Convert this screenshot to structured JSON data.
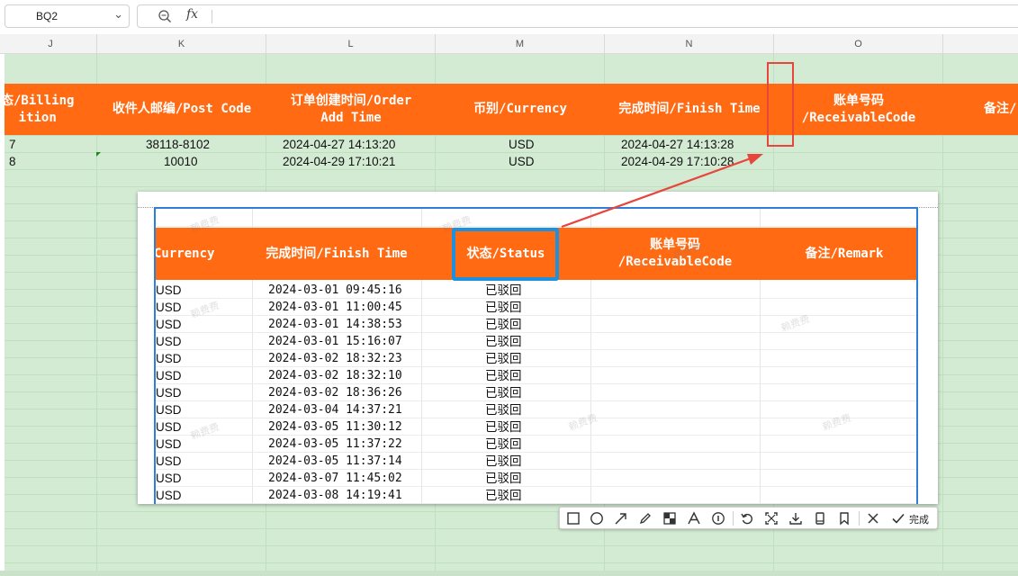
{
  "formula_bar": {
    "name_box": "BQ2",
    "zoom_icon": "zoom-icon",
    "fx_label": "fx",
    "formula": ""
  },
  "columns": [
    "J",
    "K",
    "L",
    "M",
    "N",
    "O"
  ],
  "sheet": {
    "headers": {
      "billing": "态/Billing\nition",
      "post_code": "收件人邮编/Post Code",
      "order_time": "订单创建时间/Order\nAdd Time",
      "currency": "币别/Currency",
      "finish_time": "完成时间/Finish Time",
      "receivable": "账单号码\n/ReceivableCode",
      "remark": "备注/"
    },
    "rows": [
      {
        "j": "7",
        "post_code": "38118-8102",
        "order_time": "2024-04-27  14:13:20",
        "currency": "USD",
        "finish_time": "2024-04-27  14:13:28"
      },
      {
        "j": "8",
        "post_code": "10010",
        "order_time": "2024-04-29  17:10:21",
        "currency": "USD",
        "finish_time": "2024-04-29  17:10:28"
      }
    ]
  },
  "overlay": {
    "headers": {
      "currency": "Currency",
      "finish_time": "完成时间/Finish Time",
      "status": "状态/Status",
      "receivable": "账单号码\n/ReceivableCode",
      "remark": "备注/Remark"
    },
    "rows": [
      {
        "currency": "USD",
        "finish_time": "2024-03-01  09:45:16",
        "status": "已驳回"
      },
      {
        "currency": "USD",
        "finish_time": "2024-03-01  11:00:45",
        "status": "已驳回"
      },
      {
        "currency": "USD",
        "finish_time": "2024-03-01  14:38:53",
        "status": "已驳回"
      },
      {
        "currency": "USD",
        "finish_time": "2024-03-01  15:16:07",
        "status": "已驳回"
      },
      {
        "currency": "USD",
        "finish_time": "2024-03-02  18:32:23",
        "status": "已驳回"
      },
      {
        "currency": "USD",
        "finish_time": "2024-03-02  18:32:10",
        "status": "已驳回"
      },
      {
        "currency": "USD",
        "finish_time": "2024-03-02  18:36:26",
        "status": "已驳回"
      },
      {
        "currency": "USD",
        "finish_time": "2024-03-04  14:37:21",
        "status": "已驳回"
      },
      {
        "currency": "USD",
        "finish_time": "2024-03-05  11:30:12",
        "status": "已驳回"
      },
      {
        "currency": "USD",
        "finish_time": "2024-03-05  11:37:22",
        "status": "已驳回"
      },
      {
        "currency": "USD",
        "finish_time": "2024-03-05  11:37:14",
        "status": "已驳回"
      },
      {
        "currency": "USD",
        "finish_time": "2024-03-07  11:45:02",
        "status": "已驳回"
      },
      {
        "currency": "USD",
        "finish_time": "2024-03-08  14:19:41",
        "status": "已驳回"
      }
    ],
    "watermark": "赖费费"
  },
  "toolbar": {
    "tools": [
      "rectangle-icon",
      "ellipse-icon",
      "arrow-icon",
      "pen-icon",
      "mosaic-icon",
      "text-icon",
      "number-icon",
      "undo-icon",
      "scan-icon",
      "download-icon",
      "pin-icon",
      "bookmark-icon",
      "close-icon",
      "check-icon"
    ],
    "done_label": "完成"
  },
  "colors": {
    "header_orange": "#ff6a13",
    "sheet_green": "#d3ead3",
    "highlight_red": "#e8453c",
    "highlight_blue": "#1e90e0"
  }
}
